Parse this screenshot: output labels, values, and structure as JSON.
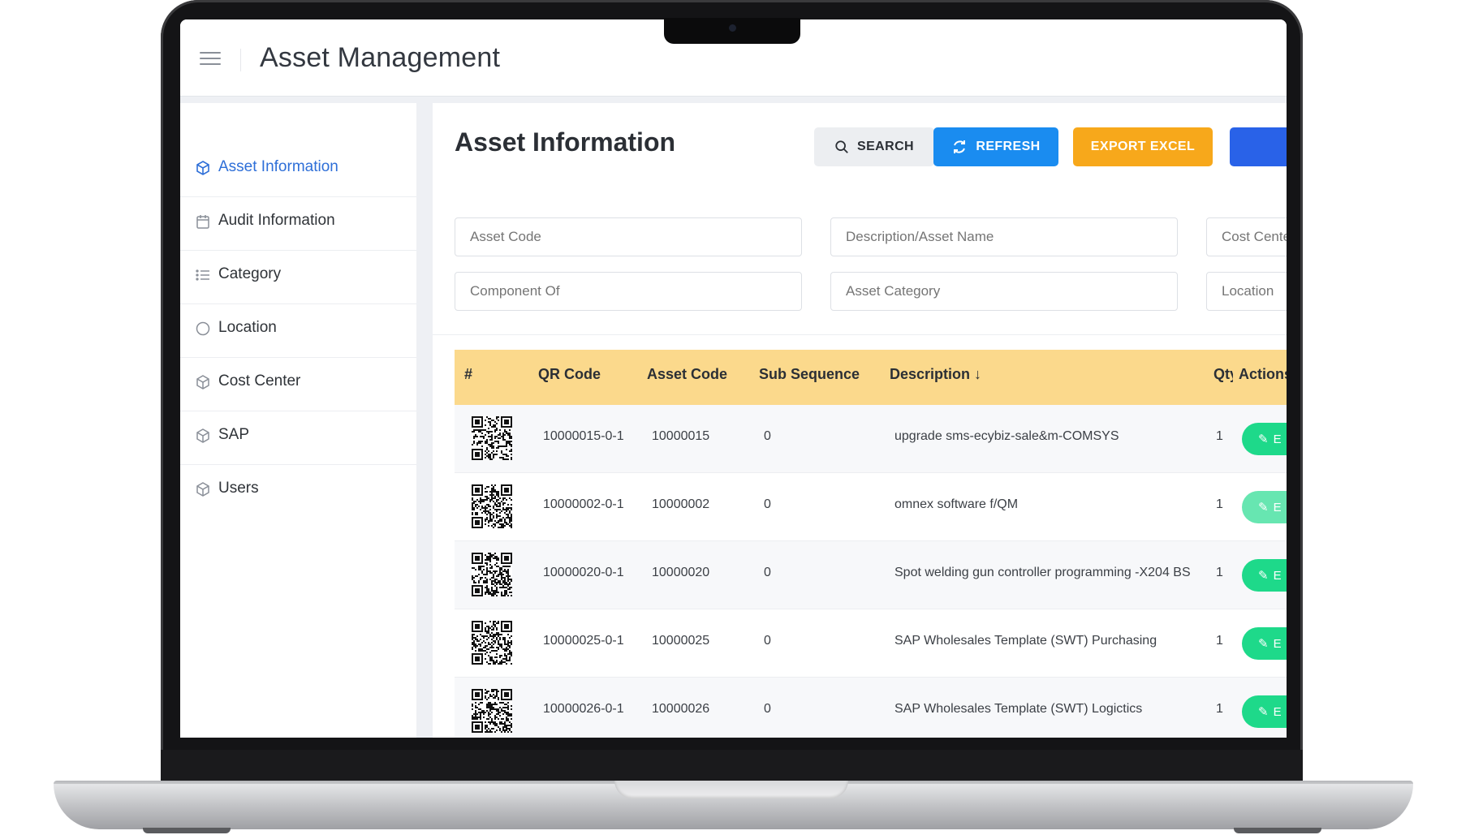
{
  "app": {
    "title": "Asset Management"
  },
  "sidebar": {
    "items": [
      {
        "label": "Asset Information",
        "icon": "cube-icon",
        "active": true
      },
      {
        "label": "Audit Information",
        "icon": "calendar-icon"
      },
      {
        "label": "Category",
        "icon": "list-icon"
      },
      {
        "label": "Location",
        "icon": "circle-icon"
      },
      {
        "label": "Cost Center",
        "icon": "cube-icon"
      },
      {
        "label": "SAP",
        "icon": "cube-icon"
      },
      {
        "label": "Users",
        "icon": "cube-icon"
      }
    ]
  },
  "page": {
    "title": "Asset Information"
  },
  "toolbar": {
    "search_label": "SEARCH",
    "refresh_label": "REFRESH",
    "export_label": "EXPORT EXCEL"
  },
  "filters": {
    "asset_code": "Asset Code",
    "description": "Description/Asset Name",
    "cost_center": "Cost Center",
    "component_of": "Component Of",
    "asset_category": "Asset Category",
    "location": "Location"
  },
  "table": {
    "columns": [
      "#",
      "QR Code",
      "Asset Code",
      "Sub Sequence",
      "Description",
      "Qty",
      "Actions"
    ],
    "rows": [
      {
        "qr": "10000015-0-1",
        "asset_code": "10000015",
        "sub_seq": "0",
        "description": "upgrade sms-ecybiz-sale&m-COMSYS",
        "qty": "1"
      },
      {
        "qr": "10000002-0-1",
        "asset_code": "10000002",
        "sub_seq": "0",
        "description": "omnex software f/QM",
        "qty": "1"
      },
      {
        "qr": "10000020-0-1",
        "asset_code": "10000020",
        "sub_seq": "0",
        "description": "Spot welding gun controller programming -X204 BS",
        "qty": "1"
      },
      {
        "qr": "10000025-0-1",
        "asset_code": "10000025",
        "sub_seq": "0",
        "description": "SAP Wholesales Template (SWT) Purchasing",
        "qty": "1"
      },
      {
        "qr": "10000026-0-1",
        "asset_code": "10000026",
        "sub_seq": "0",
        "description": "SAP Wholesales Template (SWT) Logictics",
        "qty": "1"
      }
    ],
    "edit_label": "E"
  },
  "colors": {
    "accent": "#2e6fd8",
    "refresh": "#1a8cf0",
    "export": "#f7a81b",
    "header": "#fbd98c",
    "edit": "#1ed98a"
  }
}
